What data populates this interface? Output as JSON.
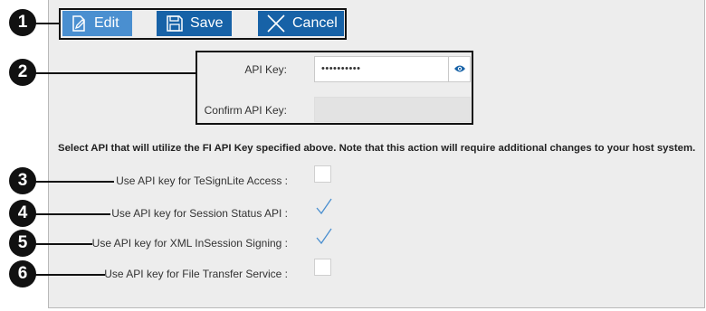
{
  "toolbar": {
    "edit_label": "Edit",
    "save_label": "Save",
    "cancel_label": "Cancel"
  },
  "api_key": {
    "label": "API Key:",
    "value": "••••••••••",
    "confirm_label": "Confirm API Key:",
    "confirm_value": ""
  },
  "notice": "Select API that will utilize the FI API Key specified above. Note that this action will require additional changes to your host system.",
  "options": [
    {
      "label": "Use API key for TeSignLite Access :",
      "checked": false
    },
    {
      "label": "Use API key for Session Status API :",
      "checked": true
    },
    {
      "label": "Use API key for XML InSession Signing :",
      "checked": true
    },
    {
      "label": "Use API key for File Transfer Service :",
      "checked": false
    }
  ],
  "callouts": [
    "1",
    "2",
    "3",
    "4",
    "5",
    "6"
  ],
  "colors": {
    "button_blue": "#1762a7",
    "button_disabled_blue": "#4a8fd0",
    "panel_bg": "#ededed",
    "eye_icon": "#1762a7",
    "check": "#4a8fd0"
  },
  "icons": {
    "edit": "edit-icon",
    "save": "save-icon",
    "cancel": "close-icon",
    "reveal": "eye-icon",
    "checked": "checkmark-icon"
  }
}
